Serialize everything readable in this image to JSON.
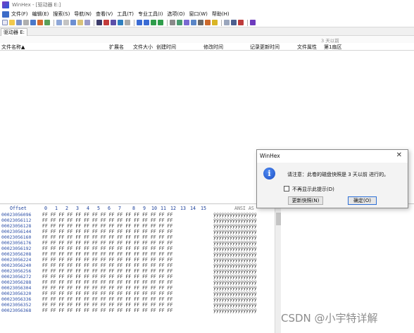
{
  "window": {
    "title": "WinHex - [驱动器 E:]"
  },
  "menu": [
    "文件(F)",
    "编辑(E)",
    "搜索(S)",
    "导航(N)",
    "查看(V)",
    "工具(T)",
    "专业工具(I)",
    "选项(O)",
    "窗口(W)",
    "帮助(H)"
  ],
  "tab": {
    "label": "驱动器 E:"
  },
  "info": {
    "snapshot_age": "3 天以前"
  },
  "directory": {
    "columns": [
      "文件名称▲",
      "扩展名",
      "文件大小",
      "创建时间",
      "修改时间",
      "记录更新时间",
      "文件属性",
      "第1扇区"
    ]
  },
  "hex": {
    "header": {
      "offset": "Offset",
      "cols": [
        "0",
        "1",
        "2",
        "3",
        "4",
        "5",
        "6",
        "7",
        "8",
        "9",
        "10",
        "11",
        "12",
        "13",
        "14",
        "15"
      ],
      "ascii": "ANSI AS"
    },
    "rows": [
      {
        "offset": "00023056096",
        "bytes": "FF FF FF FF FF FF FF FF  FF FF FF FF FF FF FF FF",
        "ascii": "ÿÿÿÿÿÿÿÿÿÿÿÿÿÿÿÿ"
      },
      {
        "offset": "00023056112",
        "bytes": "FF FF FF FF FF FF FF FF  FF FF FF FF FF FF FF FF",
        "ascii": "ÿÿÿÿÿÿÿÿÿÿÿÿÿÿÿÿ"
      },
      {
        "offset": "00023056128",
        "bytes": "FF FF FF FF FF FF FF FF  FF FF FF FF FF FF FF FF",
        "ascii": "ÿÿÿÿÿÿÿÿÿÿÿÿÿÿÿÿ"
      },
      {
        "offset": "00023056144",
        "bytes": "FF FF FF FF FF FF FF FF  FF FF FF FF FF FF FF FF",
        "ascii": "ÿÿÿÿÿÿÿÿÿÿÿÿÿÿÿÿ"
      },
      {
        "offset": "00023056160",
        "bytes": "FF FF FF FF FF FF FF FF  FF FF FF FF FF FF FF FF",
        "ascii": "ÿÿÿÿÿÿÿÿÿÿÿÿÿÿÿÿ"
      },
      {
        "offset": "00023056176",
        "bytes": "FF FF FF FF FF FF FF FF  FF FF FF FF FF FF FF FF",
        "ascii": "ÿÿÿÿÿÿÿÿÿÿÿÿÿÿÿÿ"
      },
      {
        "offset": "00023056192",
        "bytes": "FF FF FF FF FF FF FF FF  FF FF FF FF FF FF FF FF",
        "ascii": "ÿÿÿÿÿÿÿÿÿÿÿÿÿÿÿÿ"
      },
      {
        "offset": "00023056208",
        "bytes": "FF FF FF FF FF FF FF FF  FF FF FF FF FF FF FF FF",
        "ascii": "ÿÿÿÿÿÿÿÿÿÿÿÿÿÿÿÿ"
      },
      {
        "offset": "00023056224",
        "bytes": "FF FF FF FF FF FF FF FF  FF FF FF FF FF FF FF FF",
        "ascii": "ÿÿÿÿÿÿÿÿÿÿÿÿÿÿÿÿ"
      },
      {
        "offset": "00023056240",
        "bytes": "FF FF FF FF FF FF FF FF  FF FF FF FF FF FF FF FF",
        "ascii": "ÿÿÿÿÿÿÿÿÿÿÿÿÿÿÿÿ"
      },
      {
        "offset": "00023056256",
        "bytes": "FF FF FF FF FF FF FF FF  FF FF FF FF FF FF FF FF",
        "ascii": "ÿÿÿÿÿÿÿÿÿÿÿÿÿÿÿÿ"
      },
      {
        "offset": "00023056272",
        "bytes": "FF FF FF FF FF FF FF FF  FF FF FF FF FF FF FF FF",
        "ascii": "ÿÿÿÿÿÿÿÿÿÿÿÿÿÿÿÿ"
      },
      {
        "offset": "00023056288",
        "bytes": "FF FF FF FF FF FF FF FF  FF FF FF FF FF FF FF FF",
        "ascii": "ÿÿÿÿÿÿÿÿÿÿÿÿÿÿÿÿ"
      },
      {
        "offset": "00023056304",
        "bytes": "FF FF FF FF FF FF FF FF  FF FF FF FF FF FF FF FF",
        "ascii": "ÿÿÿÿÿÿÿÿÿÿÿÿÿÿÿÿ"
      },
      {
        "offset": "00023056320",
        "bytes": "FF FF FF FF FF FF FF FF  FF FF FF FF FF FF FF FF",
        "ascii": "ÿÿÿÿÿÿÿÿÿÿÿÿÿÿÿÿ"
      },
      {
        "offset": "00023056336",
        "bytes": "FF FF FF FF FF FF FF FF  FF FF FF FF FF FF FF FF",
        "ascii": "ÿÿÿÿÿÿÿÿÿÿÿÿÿÿÿÿ"
      },
      {
        "offset": "00023056352",
        "bytes": "FF FF FF FF FF FF FF FF  FF FF FF FF FF FF FF FF",
        "ascii": "ÿÿÿÿÿÿÿÿÿÿÿÿÿÿÿÿ"
      },
      {
        "offset": "00023056368",
        "bytes": "FF FF FF FF FF FF FF FF  FF FF FF FF FF FF FF FF",
        "ascii": "ÿÿÿÿÿÿÿÿÿÿÿÿÿÿÿÿ"
      }
    ]
  },
  "dialog": {
    "title": "WinHex",
    "close_glyph": "✕",
    "icon": "info-icon",
    "icon_glyph": "i",
    "message": "请注意：此卷的磁盘快照是 3 天以前 进行的。",
    "checkbox_label": "不再显示此提示(D)",
    "update_button": "更新快照(N)",
    "ok_button": "确定(O)"
  },
  "watermark": "CSDN @小宇特详解",
  "colors": {
    "offset_blue": "#2b4ea6",
    "accent": "#2d6fd6"
  }
}
